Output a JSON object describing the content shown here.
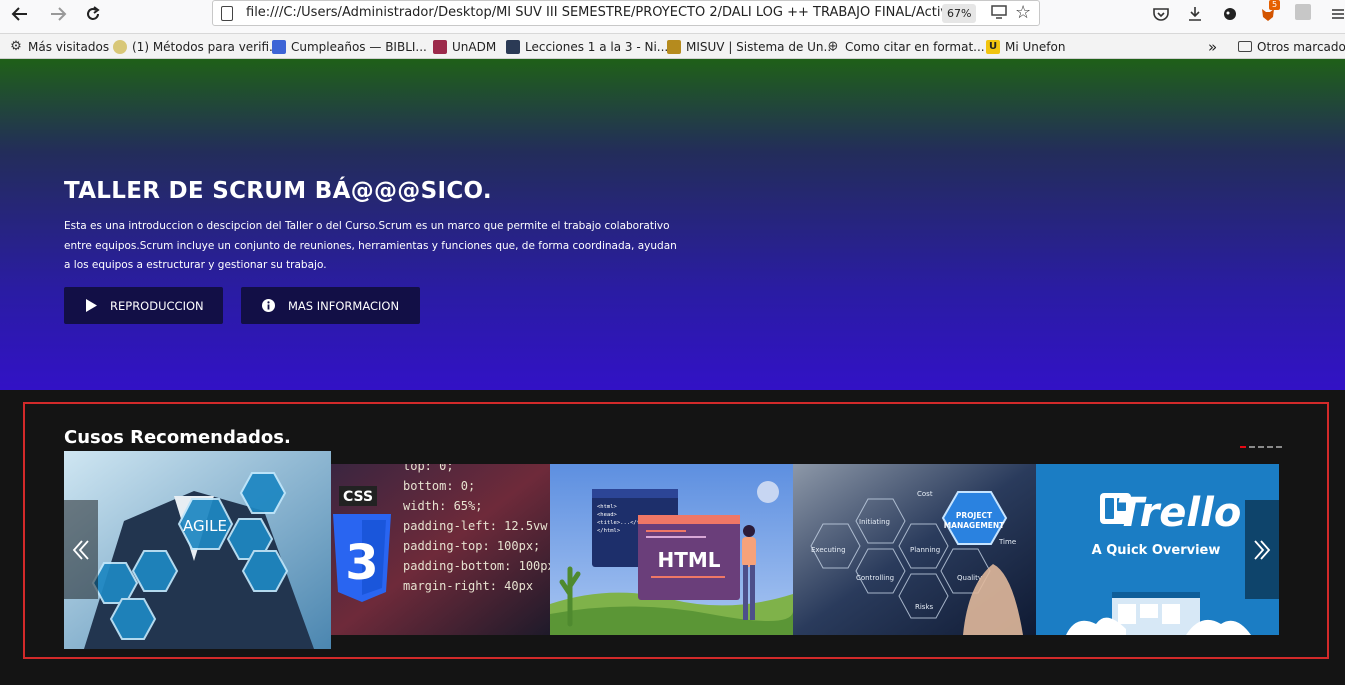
{
  "browser": {
    "url": "file:///C:/Users/Administrador/Desktop/MI SUV III SEMESTRE/PROYECTO 2/DALI LOG ++ TRABAJO FINAL/Activi",
    "zoom": "67%",
    "notification_count": "5",
    "icons": [
      "back-icon",
      "forward-icon",
      "reload-icon",
      "page-icon",
      "star-icon",
      "pocket-icon",
      "download-icon",
      "menu-icon"
    ],
    "bookmarks": [
      {
        "label": "Más visitados",
        "icon": "gear-icon"
      },
      {
        "label": "(1) Métodos para verifi...",
        "icon": "cloud-icon"
      },
      {
        "label": "Cumpleaños — BIBLI...",
        "icon": "square-icon"
      },
      {
        "label": "UnADM",
        "icon": "unadm-icon"
      },
      {
        "label": "Lecciones 1 a la 3 - Ni...",
        "icon": "photo-icon"
      },
      {
        "label": "MISUV | Sistema de Un...",
        "icon": "misuv-icon"
      },
      {
        "label": "Como citar en format...",
        "icon": "globe-icon"
      },
      {
        "label": "Mi Unefon",
        "icon": "unefon-icon"
      }
    ],
    "overflow_label": "»",
    "other_bookmarks": "Otros marcadores"
  },
  "hero": {
    "title": "TALLER DE SCRUM BÁ@@@SICO.",
    "description": "Esta es una introduccion o descipcion del Taller o del Curso.Scrum es un marco que permite el trabajo colaborativo entre equipos.Scrum incluye un conjunto de reuniones, herramientas y funciones que, de forma coordinada, ayudan a los equipos a estructurar y gestionar su trabajo.",
    "buttons": [
      {
        "label": "REPRODUCCION",
        "icon": "play-icon"
      },
      {
        "label": "MAS INFORMACION",
        "icon": "info-icon"
      }
    ]
  },
  "courses": {
    "title": "Cusos Recomendados.",
    "page_indicators": 5,
    "active_indicator": 0,
    "cards": [
      {
        "name": "agile",
        "text": "AGILE"
      },
      {
        "name": "css",
        "text": "CSS",
        "code": [
          "top: 0;",
          "bottom: 0;",
          "width: 65%;",
          "padding-left: 12.5vw",
          "padding-top: 100px;",
          "padding-bottom: 100px",
          "margin-right: 40px"
        ]
      },
      {
        "name": "html",
        "text": "HTML",
        "code": [
          "<html>",
          "<head>",
          "<title>...</title>",
          "</html>"
        ]
      },
      {
        "name": "project-management",
        "text": "PROJECT MANAGEMENT",
        "labels": [
          "Cost",
          "Initiating",
          "Planning",
          "Controlling",
          "Executing",
          "Quality",
          "Risks",
          "Time"
        ]
      },
      {
        "name": "trello",
        "text": "Trello",
        "subtitle": "A Quick Overview"
      }
    ],
    "prev_label": "‹",
    "next_label": "›"
  },
  "colors": {
    "hero_top": "#1f6018",
    "hero_bottom": "#3212c6",
    "button_bg": "#120f46",
    "frame": "#d22a2a",
    "indicator_active": "#e50914"
  }
}
